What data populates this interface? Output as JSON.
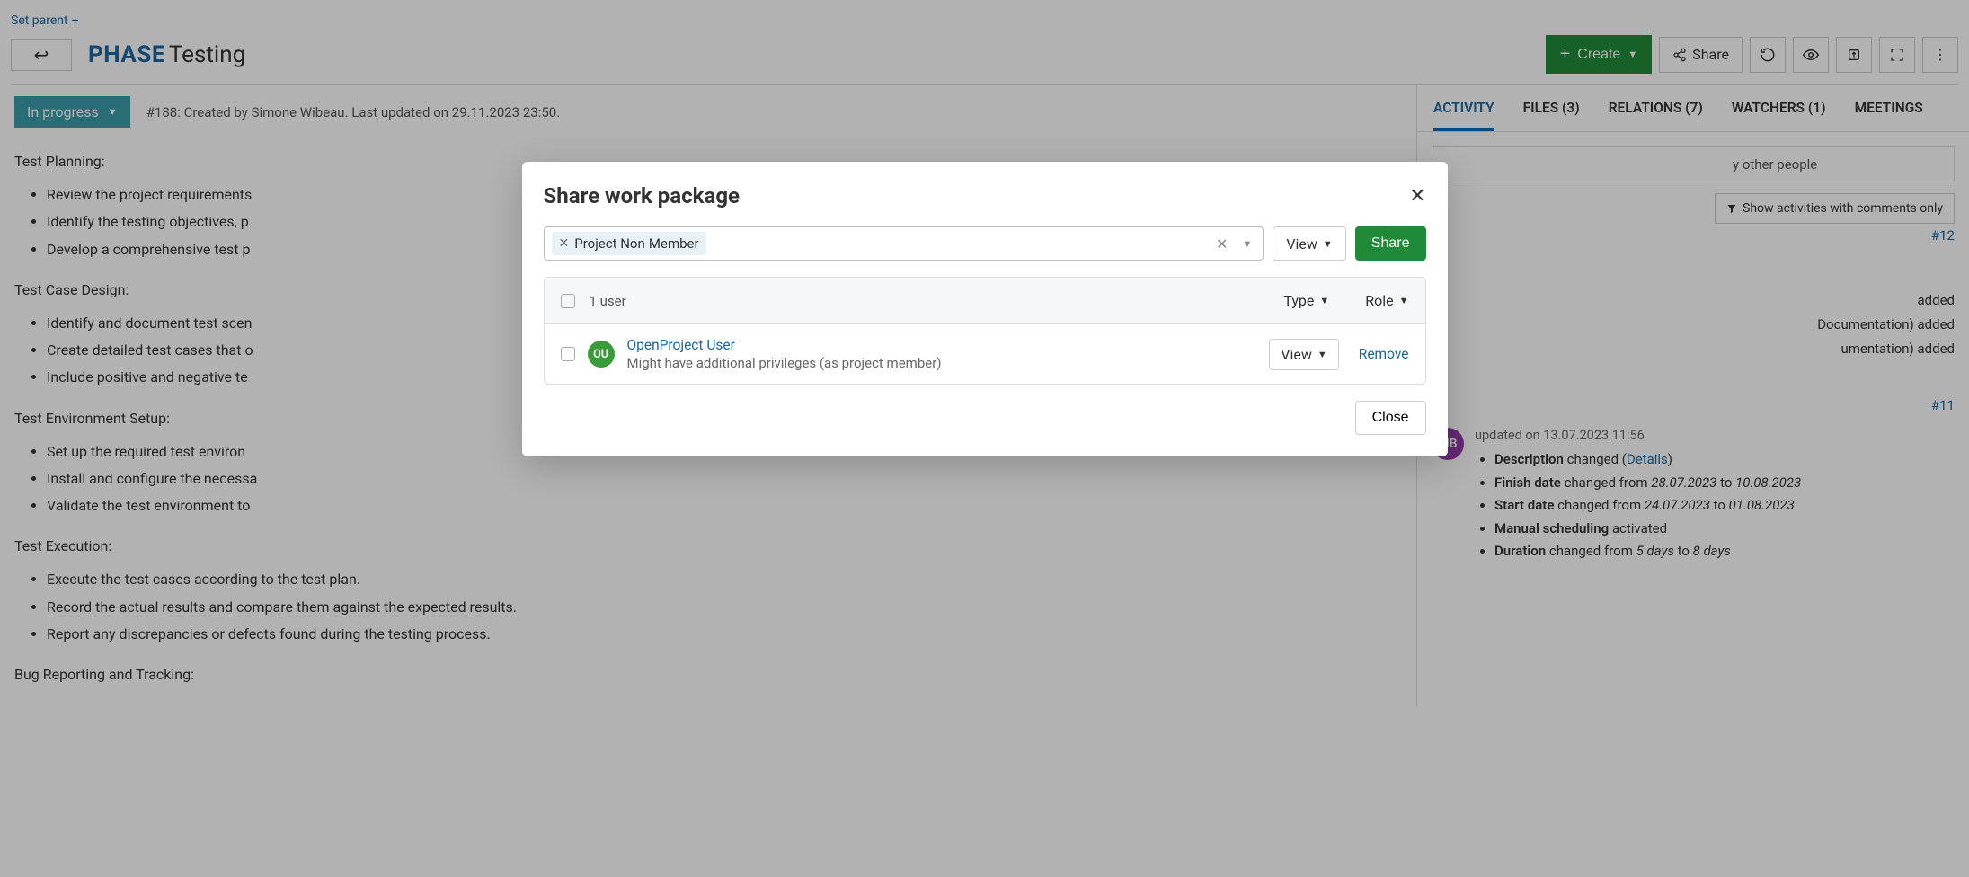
{
  "header": {
    "set_parent": "Set parent",
    "back_arrow": "↩",
    "wp_type": "PHASE",
    "wp_title": "Testing",
    "create_label": "Create",
    "share_label": "Share"
  },
  "status": {
    "label": "In progress",
    "meta": "#188: Created by Simone Wibeau. Last updated on 29.11.2023 23:50."
  },
  "description": {
    "h1": "Test Planning:",
    "b1": [
      "Review the project requirements",
      "Identify the testing objectives, p",
      "Develop a comprehensive test p"
    ],
    "h2": "Test Case Design:",
    "b2": [
      "Identify and document test scen",
      "Create detailed test cases that o",
      "Include positive and negative te"
    ],
    "h3": "Test Environment Setup:",
    "b3": [
      "Set up the required test environ",
      "Install and configure the necessa",
      "Validate the test environment to"
    ],
    "h4": "Test Execution:",
    "b4": [
      "Execute the test cases according to the test plan.",
      "Record the actual results and compare them against the expected results.",
      "Report any discrepancies or defects found during the testing process."
    ],
    "h5": "Bug Reporting and Tracking:"
  },
  "tabs": {
    "activity": "ACTIVITY",
    "files": "FILES (3)",
    "relations": "RELATIONS (7)",
    "watchers": "WATCHERS (1)",
    "meetings": "MEETINGS"
  },
  "side": {
    "notify_partial": "y other people",
    "filter_label": "Show activities with comments only",
    "ref12": "#12",
    "ref11": "#11",
    "partial_lines": [
      "added",
      "Documentation) added",
      "umentation) added"
    ],
    "entry_avatar": "MB",
    "entry_time": "updated on 13.07.2023 11:56",
    "changes": {
      "desc_label": "Description",
      "desc_changed": " changed (",
      "desc_link": "Details",
      "desc_close": ")",
      "finish_label": "Finish date",
      "finish_txt": " changed from ",
      "finish_from": "28.07.2023",
      "finish_to_word": " to ",
      "finish_to": "10.08.2023",
      "start_label": "Start date",
      "start_txt": " changed from ",
      "start_from": "24.07.2023",
      "start_to_word": " to ",
      "start_to": "01.08.2023",
      "sched_label": "Manual scheduling",
      "sched_txt": " activated",
      "dur_label": "Duration",
      "dur_txt": " changed from ",
      "dur_from": "5 days",
      "dur_to_word": " to ",
      "dur_to": "8 days"
    }
  },
  "modal": {
    "title": "Share work package",
    "chip": "Project Non-Member",
    "perm": "View",
    "share_btn": "Share",
    "count": "1 user",
    "th_type": "Type",
    "th_role": "Role",
    "user_avatar": "OU",
    "user_name": "OpenProject User",
    "user_sub": "Might have additional privileges (as project member)",
    "row_perm": "View",
    "remove": "Remove",
    "close": "Close"
  }
}
